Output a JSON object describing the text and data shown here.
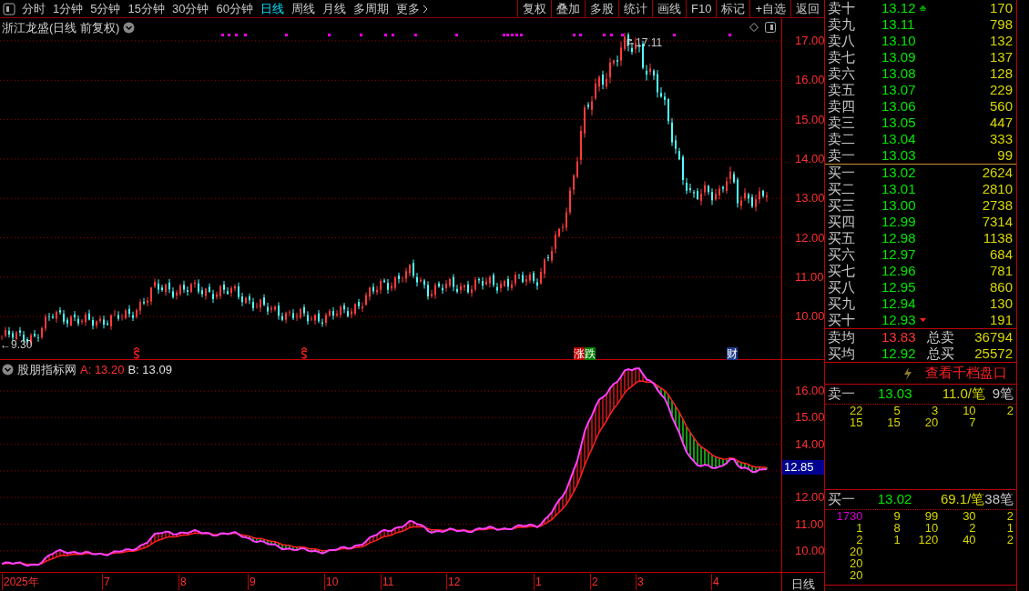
{
  "toolbar": {
    "periods": [
      {
        "label": "分时",
        "selected": false
      },
      {
        "label": "1分钟",
        "selected": false
      },
      {
        "label": "5分钟",
        "selected": false
      },
      {
        "label": "15分钟",
        "selected": false
      },
      {
        "label": "30分钟",
        "selected": false
      },
      {
        "label": "60分钟",
        "selected": false
      },
      {
        "label": "日线",
        "selected": true
      },
      {
        "label": "周线",
        "selected": false
      },
      {
        "label": "月线",
        "selected": false
      },
      {
        "label": "多周期",
        "selected": false
      }
    ],
    "more": "更多",
    "buttons": [
      "复权",
      "叠加",
      "多股",
      "统计",
      "画线",
      "F10",
      "标记",
      "+自选",
      "返回"
    ]
  },
  "stock_title": "浙江龙盛(日线 前复权)",
  "price_chart": {
    "yticks": [
      "17.00",
      "16.00",
      "15.00",
      "14.00",
      "13.00",
      "12.00",
      "11.00",
      "10.00"
    ],
    "high_label": "17.11",
    "low_label": "←9.30",
    "events": [
      {
        "kind": "dividend"
      },
      {
        "kind": "dividend"
      },
      {
        "kind": "updown",
        "labels": [
          "涨",
          "跌"
        ]
      },
      {
        "kind": "finance",
        "label": "财"
      }
    ]
  },
  "indicator": {
    "name": "股朋指标网",
    "a": "A: 13.20",
    "b": "B: 13.09",
    "yticks": [
      "16.00",
      "15.00",
      "14.00",
      "12.00",
      "11.00",
      "10.00"
    ],
    "current": "12.85"
  },
  "x_axis": {
    "labels": [
      "2025年",
      "7",
      "8",
      "9",
      "10",
      "11",
      "12",
      "1",
      "2",
      "3",
      "4"
    ],
    "period": "日线"
  },
  "order_book": {
    "asks": [
      {
        "label": "卖十",
        "price": "13.12",
        "volume": "170",
        "flagged": true
      },
      {
        "label": "卖九",
        "price": "13.11",
        "volume": "798",
        "flagged": false
      },
      {
        "label": "卖八",
        "price": "13.10",
        "volume": "132",
        "flagged": false
      },
      {
        "label": "卖七",
        "price": "13.09",
        "volume": "137",
        "flagged": false
      },
      {
        "label": "卖六",
        "price": "13.08",
        "volume": "128",
        "flagged": false
      },
      {
        "label": "卖五",
        "price": "13.07",
        "volume": "229",
        "flagged": false
      },
      {
        "label": "卖四",
        "price": "13.06",
        "volume": "560",
        "flagged": false
      },
      {
        "label": "卖三",
        "price": "13.05",
        "volume": "447",
        "flagged": false
      },
      {
        "label": "卖二",
        "price": "13.04",
        "volume": "333",
        "flagged": false
      },
      {
        "label": "卖一",
        "price": "13.03",
        "volume": "99",
        "flagged": false
      }
    ],
    "bids": [
      {
        "label": "买一",
        "price": "13.02",
        "volume": "2624",
        "flagged": false
      },
      {
        "label": "买二",
        "price": "13.01",
        "volume": "2810",
        "flagged": false
      },
      {
        "label": "买三",
        "price": "13.00",
        "volume": "2738",
        "flagged": false
      },
      {
        "label": "买四",
        "price": "12.99",
        "volume": "7314",
        "flagged": false
      },
      {
        "label": "买五",
        "price": "12.98",
        "volume": "1138",
        "flagged": false
      },
      {
        "label": "买六",
        "price": "12.97",
        "volume": "684",
        "flagged": false
      },
      {
        "label": "买七",
        "price": "12.96",
        "volume": "781",
        "flagged": false
      },
      {
        "label": "买八",
        "price": "12.95",
        "volume": "860",
        "flagged": false
      },
      {
        "label": "买九",
        "price": "12.94",
        "volume": "130",
        "flagged": false
      },
      {
        "label": "买十",
        "price": "12.93",
        "volume": "191",
        "flagged": true
      }
    ],
    "averages": [
      {
        "label": "卖均",
        "price": "13.83",
        "color": "#ff3232",
        "total_label": "总卖",
        "total": "36794"
      },
      {
        "label": "买均",
        "price": "12.92",
        "color": "#00e600",
        "total_label": "总买",
        "total": "25572"
      }
    ]
  },
  "depth_link": "查看千档盘口",
  "queues": [
    {
      "label": "卖一",
      "price": "13.03",
      "avg": "11.0/笔",
      "count": "9笔",
      "rows": [
        {
          "cells": [
            "22",
            "5",
            "3",
            "10",
            "2"
          ],
          "large_first": false
        },
        {
          "cells": [
            "15",
            "15",
            "20",
            "7"
          ],
          "large_first": false
        }
      ]
    },
    {
      "label": "买一",
      "price": "13.02",
      "avg": "69.1/笔",
      "count": "38笔",
      "rows": [
        {
          "cells": [
            "1730",
            "9",
            "99",
            "30",
            "2"
          ],
          "large_first": true
        },
        {
          "cells": [
            "1",
            "8",
            "10",
            "2",
            "1"
          ],
          "large_first": false
        },
        {
          "cells": [
            "2",
            "1",
            "120",
            "40",
            "2"
          ],
          "large_first": false
        },
        {
          "cells": [
            "20"
          ],
          "large_first": false
        },
        {
          "cells": [
            "20"
          ],
          "large_first": false
        },
        {
          "cells": [
            "20"
          ],
          "large_first": false
        }
      ]
    }
  ]
}
